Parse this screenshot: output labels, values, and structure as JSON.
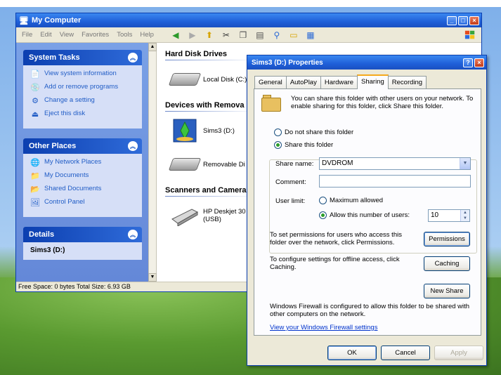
{
  "my_computer": {
    "title": "My Computer",
    "menu": [
      "File",
      "Edit",
      "View",
      "Favorites",
      "Tools",
      "Help"
    ],
    "task_panels": [
      {
        "title": "System Tasks",
        "items": [
          {
            "label": "View system information",
            "icon": "info-icon"
          },
          {
            "label": "Add or remove programs",
            "icon": "programs-icon"
          },
          {
            "label": "Change a setting",
            "icon": "settings-icon"
          },
          {
            "label": "Eject this disk",
            "icon": "eject-icon"
          }
        ]
      },
      {
        "title": "Other Places",
        "items": [
          {
            "label": "My Network Places",
            "icon": "network-icon"
          },
          {
            "label": "My Documents",
            "icon": "documents-icon"
          },
          {
            "label": "Shared Documents",
            "icon": "shared-folder-icon"
          },
          {
            "label": "Control Panel",
            "icon": "control-panel-icon"
          }
        ]
      },
      {
        "title": "Details",
        "items": [
          {
            "label": "Sims3 (D:)",
            "icon": ""
          }
        ]
      }
    ],
    "sections": [
      {
        "title": "Hard Disk Drives",
        "items": [
          {
            "label": "Local Disk (C:)",
            "icon": "hard-disk-icon"
          }
        ]
      },
      {
        "title": "Devices with Remova",
        "items": [
          {
            "label": "Sims3 (D:)",
            "icon": "sims-disc-icon"
          },
          {
            "label": "Removable Di",
            "icon": "removable-disk-icon"
          }
        ]
      },
      {
        "title": "Scanners and Camera",
        "items": [
          {
            "label": "HP Deskjet 30 (USB)",
            "icon": "scanner-icon"
          }
        ]
      }
    ],
    "status_bar": "Free Space: 0 bytes Total Size: 6.93 GB"
  },
  "properties": {
    "title": "Sims3 (D:) Properties",
    "tabs": [
      "General",
      "AutoPlay",
      "Hardware",
      "Sharing",
      "Recording"
    ],
    "active_tab": "Sharing",
    "intro": "You can share this folder with other users on your network. To enable sharing for this folder, click Share this folder.",
    "radio_not_share": "Do not share this folder",
    "radio_share": "Share this folder",
    "share_name_label": "Share name:",
    "share_name_value": "DVDROM",
    "comment_label": "Comment:",
    "comment_value": "",
    "user_limit_label": "User limit:",
    "max_allowed": "Maximum allowed",
    "allow_this": "Allow this number of users:",
    "user_count": "10",
    "permissions_text": "To set permissions for users who access this folder over the network, click Permissions.",
    "permissions_button": "Permissions",
    "caching_text": "To configure settings for offline access, click Caching.",
    "caching_button": "Caching",
    "new_share_button": "New Share",
    "firewall_text": "Windows Firewall is configured to allow this folder to be shared with other computers on the network.",
    "firewall_link": "View your Windows Firewall settings",
    "ok": "OK",
    "cancel": "Cancel",
    "apply": "Apply"
  }
}
